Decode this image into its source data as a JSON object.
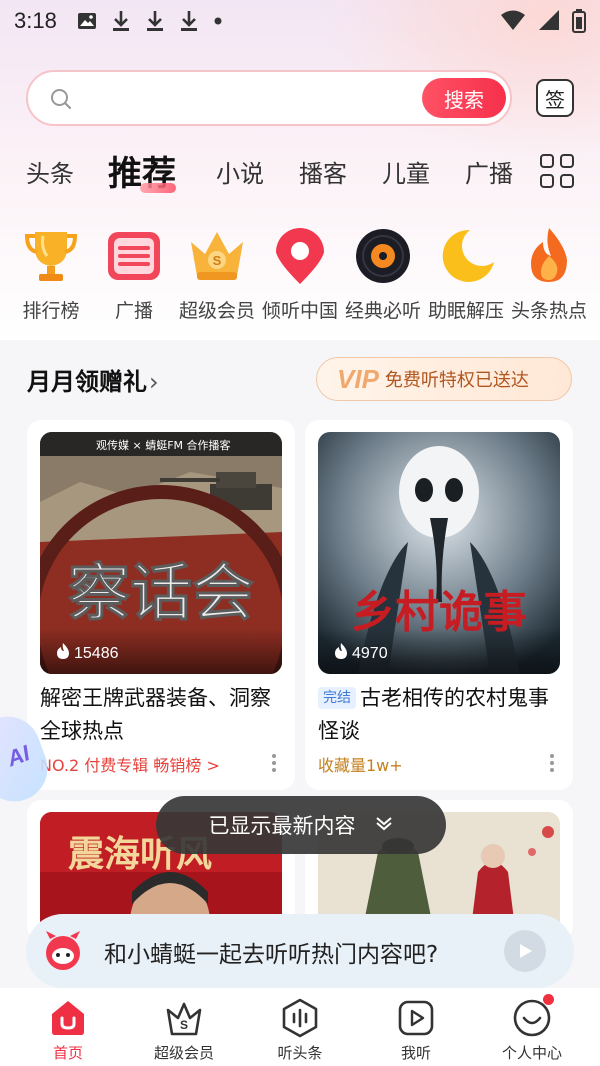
{
  "status_bar": {
    "time": "3:18",
    "icons_left": [
      "image-icon",
      "download-icon",
      "download-icon",
      "download-icon",
      "dot-icon"
    ],
    "icons_right": [
      "wifi-icon",
      "signal-icon",
      "battery-icon"
    ]
  },
  "search": {
    "placeholder": "",
    "button_label": "搜索",
    "sign_label": "签"
  },
  "tabs": [
    {
      "label": "头条",
      "active": false
    },
    {
      "label": "推荐",
      "active": true
    },
    {
      "label": "小说",
      "active": false
    },
    {
      "label": "播客",
      "active": false
    },
    {
      "label": "儿童",
      "active": false
    },
    {
      "label": "广播",
      "active": false
    }
  ],
  "quick_entries": [
    {
      "label": "排行榜",
      "icon": "trophy-icon"
    },
    {
      "label": "广播",
      "icon": "radio-icon"
    },
    {
      "label": "超级会员",
      "icon": "crown-icon"
    },
    {
      "label": "倾听中国",
      "icon": "map-pin-icon"
    },
    {
      "label": "经典必听",
      "icon": "vinyl-icon"
    },
    {
      "label": "助眠解压",
      "icon": "moon-icon"
    },
    {
      "label": "头条热点",
      "icon": "flame-icon"
    }
  ],
  "gift_section": {
    "title": "月月领赠礼",
    "arrow": "›",
    "vip_badge": "VIP",
    "vip_text": "免费听特权已送达"
  },
  "cards": [
    {
      "cover_brand": "观传媒 × 蜻蜓FM 合作播客",
      "cover_title": "察话会",
      "plays": "15486",
      "tag": "",
      "title": "解密王牌武器装备、洞察全球热点",
      "subtitle": "NO.2 付费专辑 畅销榜 >",
      "subtitle_color": "#e8423d"
    },
    {
      "cover_brand": "",
      "cover_title": "乡村诡事",
      "plays": "4970",
      "tag": "完结",
      "title": "古老相传的农村鬼事怪谈",
      "subtitle": "收藏量1w+",
      "subtitle_color": "#c4811f"
    }
  ],
  "second_row": [
    {
      "cover_title": "震海听风"
    },
    {
      "cover_title": ""
    }
  ],
  "ai_badge": "AI",
  "toast": {
    "text": "已显示最新内容"
  },
  "chat_bar": {
    "text": "和小蜻蜓一起去听听热门内容吧?"
  },
  "bottom_nav": [
    {
      "label": "首页",
      "icon": "home-icon",
      "active": true
    },
    {
      "label": "超级会员",
      "icon": "vip-bag-icon",
      "active": false
    },
    {
      "label": "听头条",
      "icon": "audio-wave-icon",
      "active": false
    },
    {
      "label": "我听",
      "icon": "play-box-icon",
      "active": false
    },
    {
      "label": "个人中心",
      "icon": "profile-icon",
      "active": false,
      "badge_dot": true
    }
  ],
  "colors": {
    "accent": "#f3354b",
    "vip_gold": "#f0a86e",
    "toast_bg": "#373737"
  }
}
